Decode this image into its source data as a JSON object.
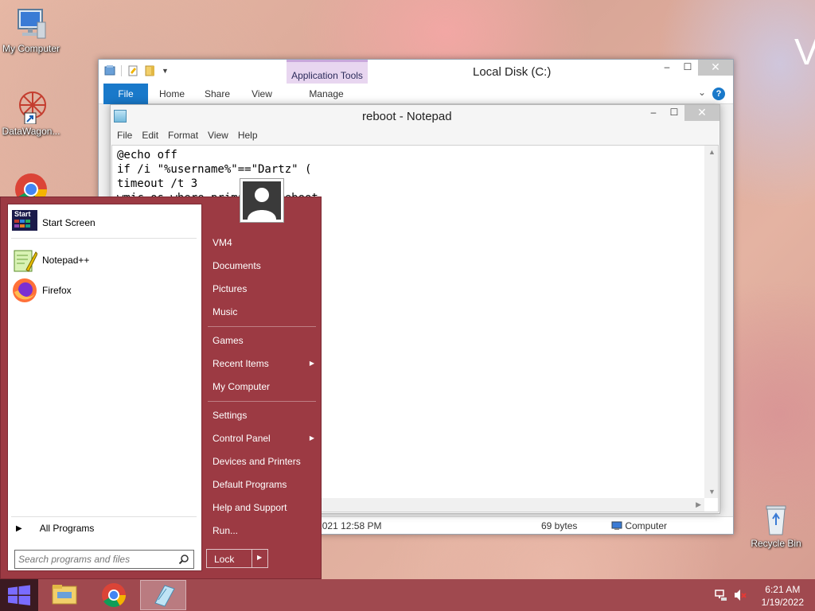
{
  "desktop": {
    "icons": [
      {
        "label": "My Computer",
        "icon": "computer-icon"
      },
      {
        "label": "DataWagon...",
        "icon": "datawagon-icon"
      },
      {
        "label": "",
        "icon": "chrome-icon"
      },
      {
        "label": "Recycle Bin",
        "icon": "recycle-bin-icon"
      }
    ],
    "watermark": "V"
  },
  "explorer": {
    "title": "Local Disk (C:)",
    "contextual_tab_group": "Application Tools",
    "ribbon_tabs": [
      "File",
      "Home",
      "Share",
      "View",
      "Manage"
    ],
    "status": {
      "modified": "Date modified: 12/23/2021 12:58 PM",
      "size": "69 bytes",
      "location": "Computer"
    },
    "window_buttons": {
      "minimize": "–",
      "maximize": "☐",
      "close": "✕"
    }
  },
  "notepad": {
    "title": "reboot - Notepad",
    "menu": [
      "File",
      "Edit",
      "Format",
      "View",
      "Help"
    ],
    "content": "@echo off\nif /i \"%username%\"==\"Dartz\" (\ntimeout /t 3\nwmic os where primary=1 reboot",
    "window_buttons": {
      "minimize": "–",
      "maximize": "☐",
      "close": "✕"
    }
  },
  "start_menu": {
    "pinned": [
      {
        "label": "Start Screen",
        "icon": "start-screen-icon"
      },
      {
        "label": "Notepad++",
        "icon": "notepadpp-icon"
      },
      {
        "label": "Firefox",
        "icon": "firefox-icon"
      }
    ],
    "all_programs": "All Programs",
    "search_placeholder": "Search programs and files",
    "right_items": [
      {
        "label": "VM4",
        "submenu": false
      },
      {
        "label": "Documents",
        "submenu": false
      },
      {
        "label": "Pictures",
        "submenu": false
      },
      {
        "label": "Music",
        "submenu": false
      },
      {
        "label": "Games",
        "submenu": false
      },
      {
        "label": "Recent Items",
        "submenu": true
      },
      {
        "label": "My Computer",
        "submenu": false
      },
      {
        "label": "Settings",
        "submenu": false
      },
      {
        "label": "Control Panel",
        "submenu": true
      },
      {
        "label": "Devices and Printers",
        "submenu": false
      },
      {
        "label": "Default Programs",
        "submenu": false
      },
      {
        "label": "Help and Support",
        "submenu": false
      },
      {
        "label": "Run...",
        "submenu": false
      }
    ],
    "lock_label": "Lock",
    "start_tile_label": "Start"
  },
  "taskbar": {
    "apps": [
      "file-explorer-icon",
      "chrome-icon",
      "notepad-icon"
    ],
    "clock_time": "6:21 AM",
    "clock_date": "1/19/2022"
  },
  "colors": {
    "start_menu": "#9c3a43",
    "taskbar": "#a0494f",
    "ribbon_file": "#1979ca"
  }
}
